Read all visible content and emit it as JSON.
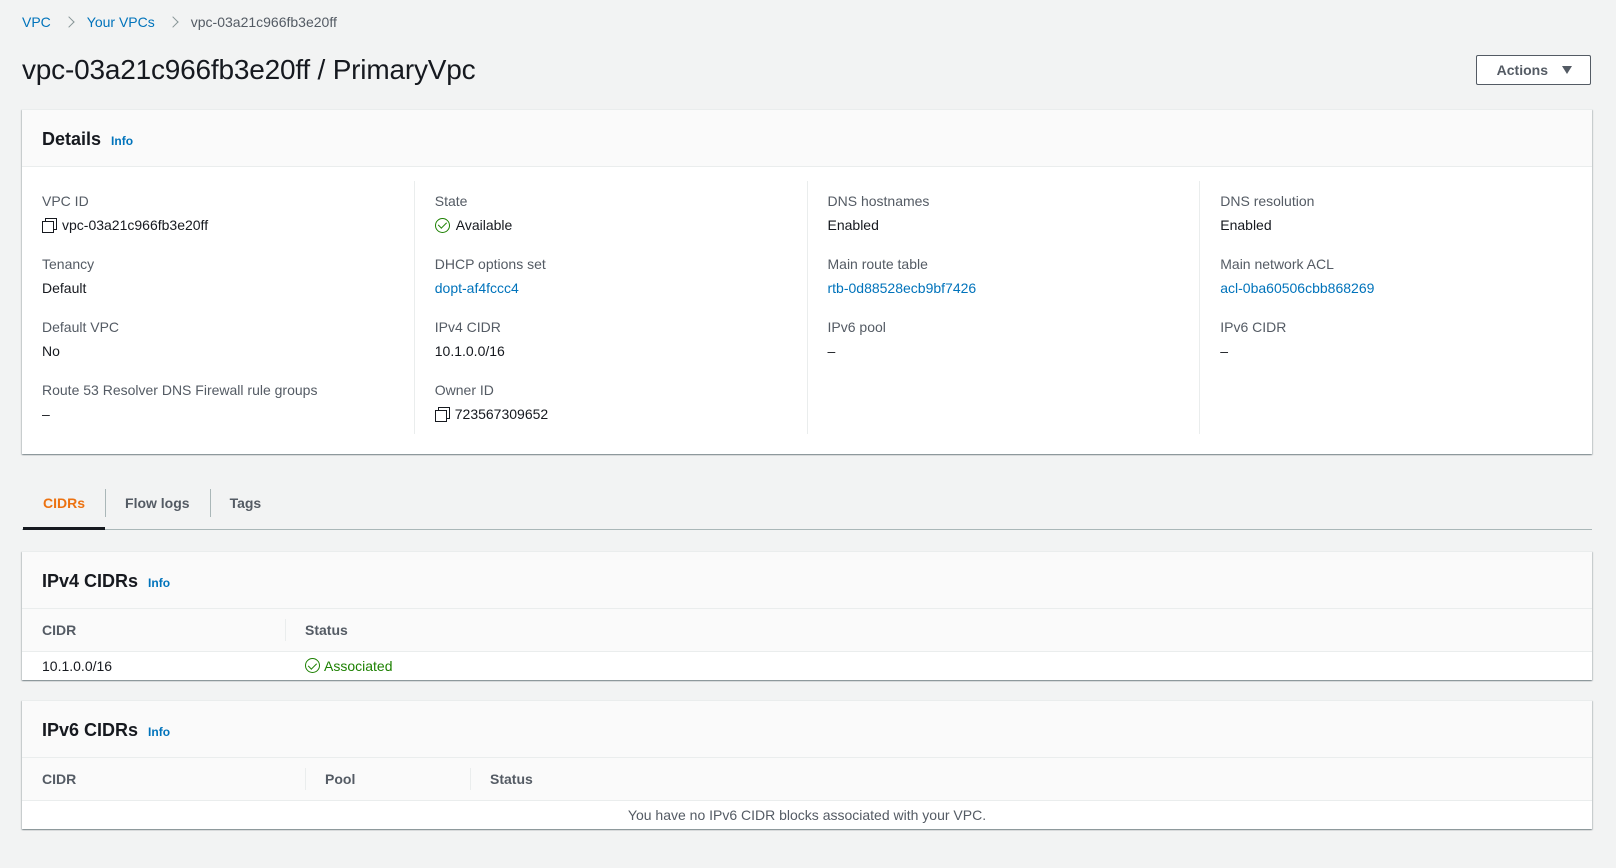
{
  "breadcrumb": {
    "items": [
      "VPC",
      "Your VPCs"
    ],
    "current": "vpc-03a21c966fb3e20ff"
  },
  "header": {
    "title": "vpc-03a21c966fb3e20ff / PrimaryVpc",
    "actions_label": "Actions"
  },
  "details": {
    "title": "Details",
    "info": "Info",
    "vpc_id": {
      "label": "VPC ID",
      "value": "vpc-03a21c966fb3e20ff"
    },
    "tenancy": {
      "label": "Tenancy",
      "value": "Default"
    },
    "default_vpc": {
      "label": "Default VPC",
      "value": "No"
    },
    "route53": {
      "label": "Route 53 Resolver DNS Firewall rule groups",
      "value": "–"
    },
    "state": {
      "label": "State",
      "value": "Available"
    },
    "dhcp": {
      "label": "DHCP options set",
      "value": "dopt-af4fccc4"
    },
    "ipv4_cidr": {
      "label": "IPv4 CIDR",
      "value": "10.1.0.0/16"
    },
    "owner_id": {
      "label": "Owner ID",
      "value": "723567309652"
    },
    "dns_hostnames": {
      "label": "DNS hostnames",
      "value": "Enabled"
    },
    "main_route_table": {
      "label": "Main route table",
      "value": "rtb-0d88528ecb9bf7426"
    },
    "ipv6_pool": {
      "label": "IPv6 pool",
      "value": "–"
    },
    "dns_resolution": {
      "label": "DNS resolution",
      "value": "Enabled"
    },
    "main_network_acl": {
      "label": "Main network ACL",
      "value": "acl-0ba60506cbb868269"
    },
    "ipv6_cidr": {
      "label": "IPv6 CIDR",
      "value": "–"
    }
  },
  "tabs": [
    "CIDRs",
    "Flow logs",
    "Tags"
  ],
  "ipv4_cidrs": {
    "title": "IPv4 CIDRs",
    "info": "Info",
    "columns": [
      "CIDR",
      "Status"
    ],
    "rows": [
      {
        "cidr": "10.1.0.0/16",
        "status": "Associated"
      }
    ]
  },
  "ipv6_cidrs": {
    "title": "IPv6 CIDRs",
    "info": "Info",
    "columns": [
      "CIDR",
      "Pool",
      "Status"
    ],
    "empty_message": "You have no IPv6 CIDR blocks associated with your VPC."
  },
  "colors": {
    "link": "#0073bb",
    "success": "#1d8102",
    "active_tab": "#ec7211"
  }
}
